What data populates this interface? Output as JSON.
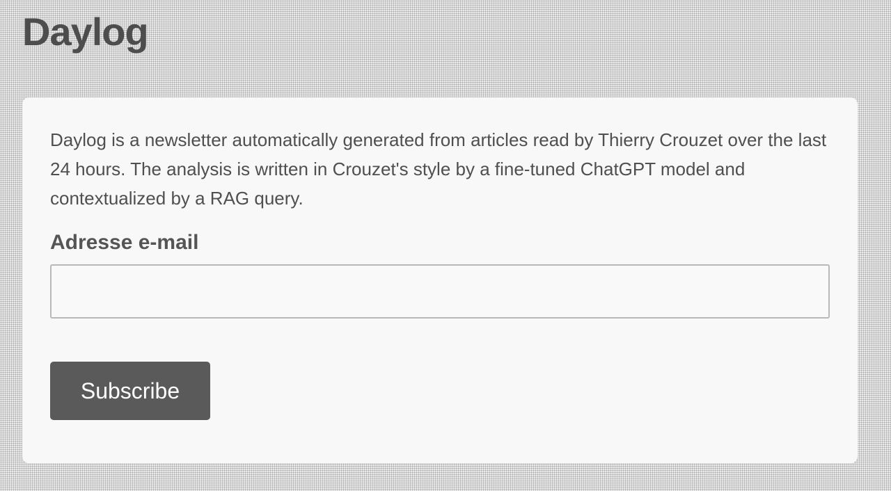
{
  "site": {
    "title": "Daylog"
  },
  "signup": {
    "description": "Daylog is a newsletter automatically generated from articles read by Thierry Crouzet over the last 24 hours. The analysis is written in Crouzet's style by a fine-tuned ChatGPT model and contextualized by a RAG query.",
    "email_label": "Adresse e-mail",
    "email_value": "",
    "subscribe_label": "Subscribe"
  },
  "colors": {
    "page_background": "#e9e9e9",
    "card_background": "#f8f8f8",
    "text": "#4a4a4a",
    "button": "#5a5a5a",
    "button_text": "#ffffff"
  }
}
